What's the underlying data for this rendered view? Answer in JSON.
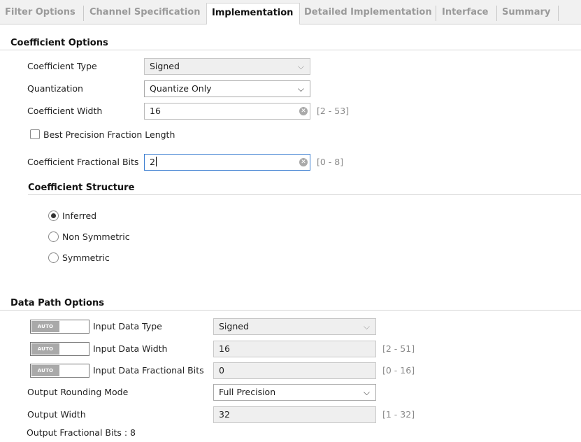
{
  "tabs": [
    {
      "label": "Filter Options"
    },
    {
      "label": "Channel Specification"
    },
    {
      "label": "Implementation"
    },
    {
      "label": "Detailed Implementation"
    },
    {
      "label": "Interface"
    },
    {
      "label": "Summary"
    }
  ],
  "coefficient_options": {
    "title": "Coefficient Options",
    "type": {
      "label": "Coefficient Type",
      "value": "Signed"
    },
    "quantization": {
      "label": "Quantization",
      "value": "Quantize Only"
    },
    "width": {
      "label": "Coefficient Width",
      "value": "16",
      "range": "[2 - 53]"
    },
    "best_precision": {
      "label": "Best Precision Fraction Length",
      "checked": false
    },
    "fractional_bits": {
      "label": "Coefficient Fractional Bits",
      "value": "2",
      "range": "[0 - 8]"
    }
  },
  "coefficient_structure": {
    "title": "Coefficient Structure",
    "options": [
      {
        "label": "Inferred",
        "selected": true
      },
      {
        "label": "Non Symmetric",
        "selected": false
      },
      {
        "label": "Symmetric",
        "selected": false
      }
    ]
  },
  "data_path": {
    "title": "Data Path Options",
    "auto_label": "AUTO",
    "input_type": {
      "label": "Input Data Type",
      "value": "Signed"
    },
    "input_width": {
      "label": "Input Data Width",
      "value": "16",
      "range": "[2 - 51]"
    },
    "input_frac": {
      "label": "Input Data Fractional Bits",
      "value": "0",
      "range": "[0 - 16]"
    },
    "rounding": {
      "label": "Output Rounding Mode",
      "value": "Full Precision"
    },
    "output_width": {
      "label": "Output Width",
      "value": "32",
      "range": "[1 - 32]"
    },
    "output_frac": {
      "label": "Output Fractional Bits : 8"
    }
  },
  "icons": {
    "chevron": "chevron-down-icon",
    "clear": "clear-icon"
  }
}
